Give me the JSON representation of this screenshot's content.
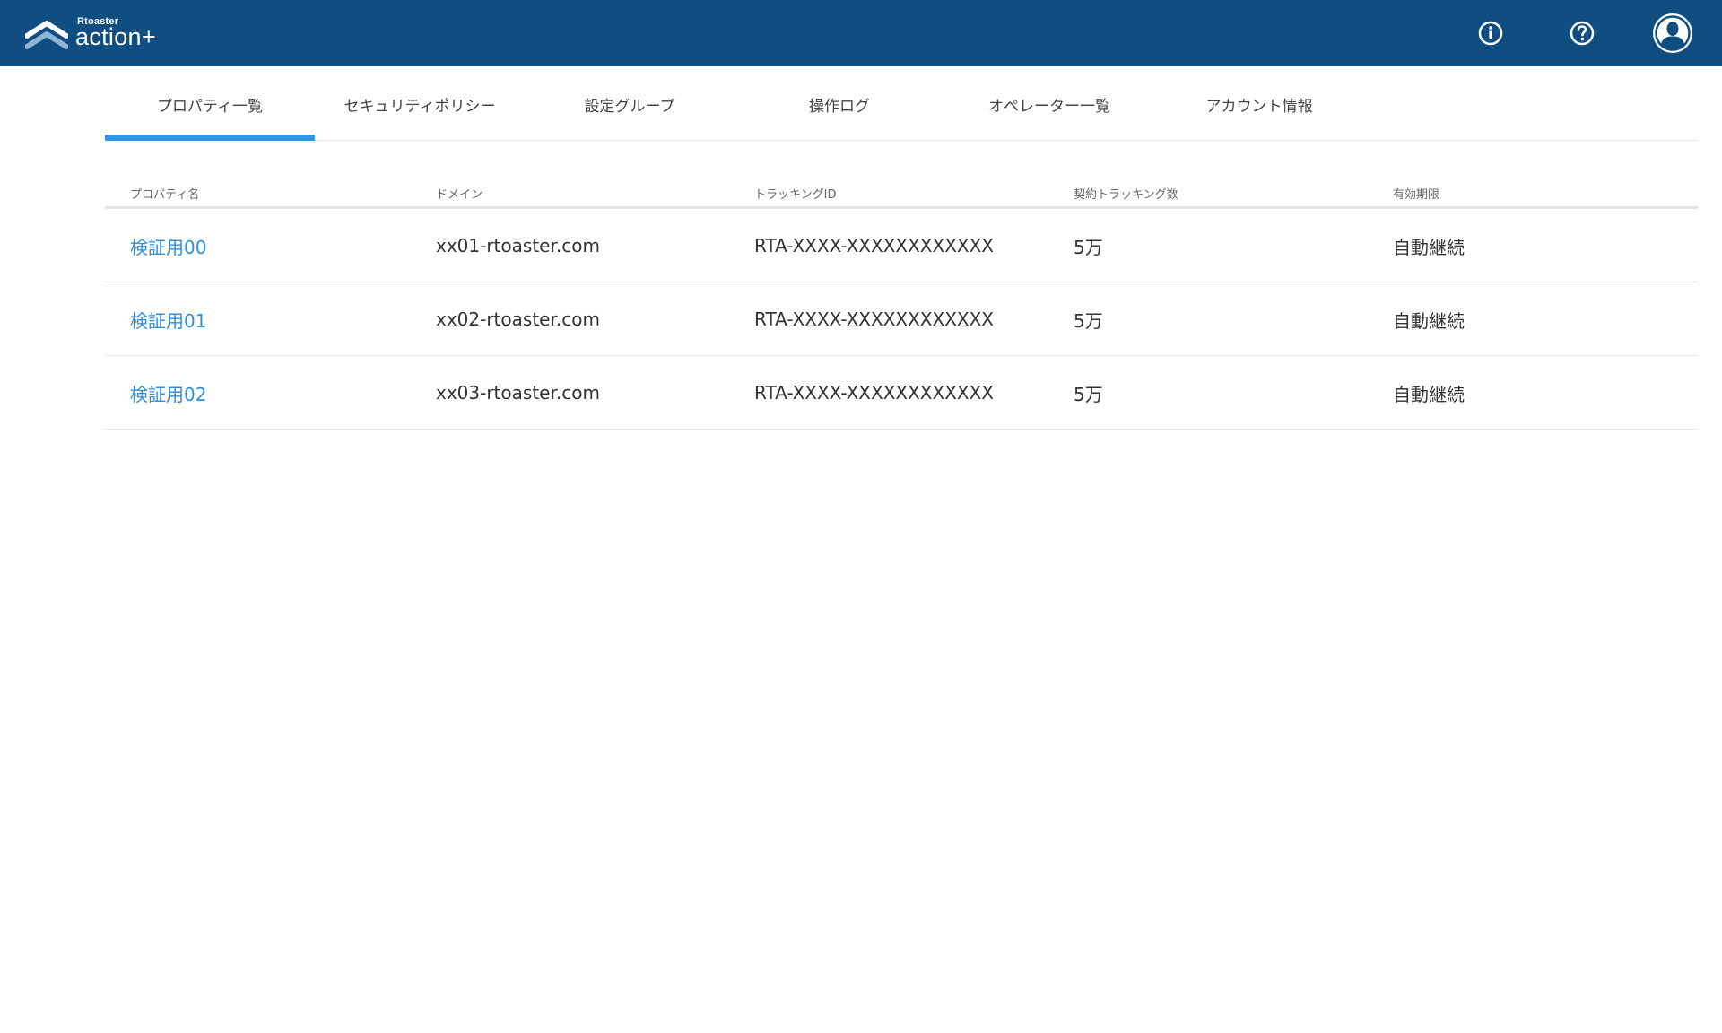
{
  "header": {
    "brand_small": "Rtoaster",
    "brand_big": "action+",
    "icons": {
      "info": "info-circle-icon",
      "help": "help-circle-icon",
      "account": "user-avatar-icon"
    },
    "colors": {
      "bar": "#104d80",
      "accent": "#2f97e8",
      "link": "#2f8fdc"
    }
  },
  "tabs": [
    {
      "label": "プロパティ一覧",
      "active": true
    },
    {
      "label": "セキュリティポリシー",
      "active": false
    },
    {
      "label": "設定グループ",
      "active": false
    },
    {
      "label": "操作ログ",
      "active": false
    },
    {
      "label": "オペレーター一覧",
      "active": false
    },
    {
      "label": "アカウント情報",
      "active": false
    }
  ],
  "table": {
    "columns": [
      "プロパティ名",
      "ドメイン",
      "トラッキングID",
      "契約トラッキング数",
      "有効期限"
    ],
    "rows": [
      [
        "検証用00",
        "xx01-rtoaster.com",
        "RTA-XXXX-XXXXXXXXXXXX",
        "5万",
        "自動継続"
      ],
      [
        "検証用01",
        "xx02-rtoaster.com",
        "RTA-XXXX-XXXXXXXXXXXX",
        "5万",
        "自動継続"
      ],
      [
        "検証用02",
        "xx03-rtoaster.com",
        "RTA-XXXX-XXXXXXXXXXXX",
        "5万",
        "自動継続"
      ]
    ]
  }
}
